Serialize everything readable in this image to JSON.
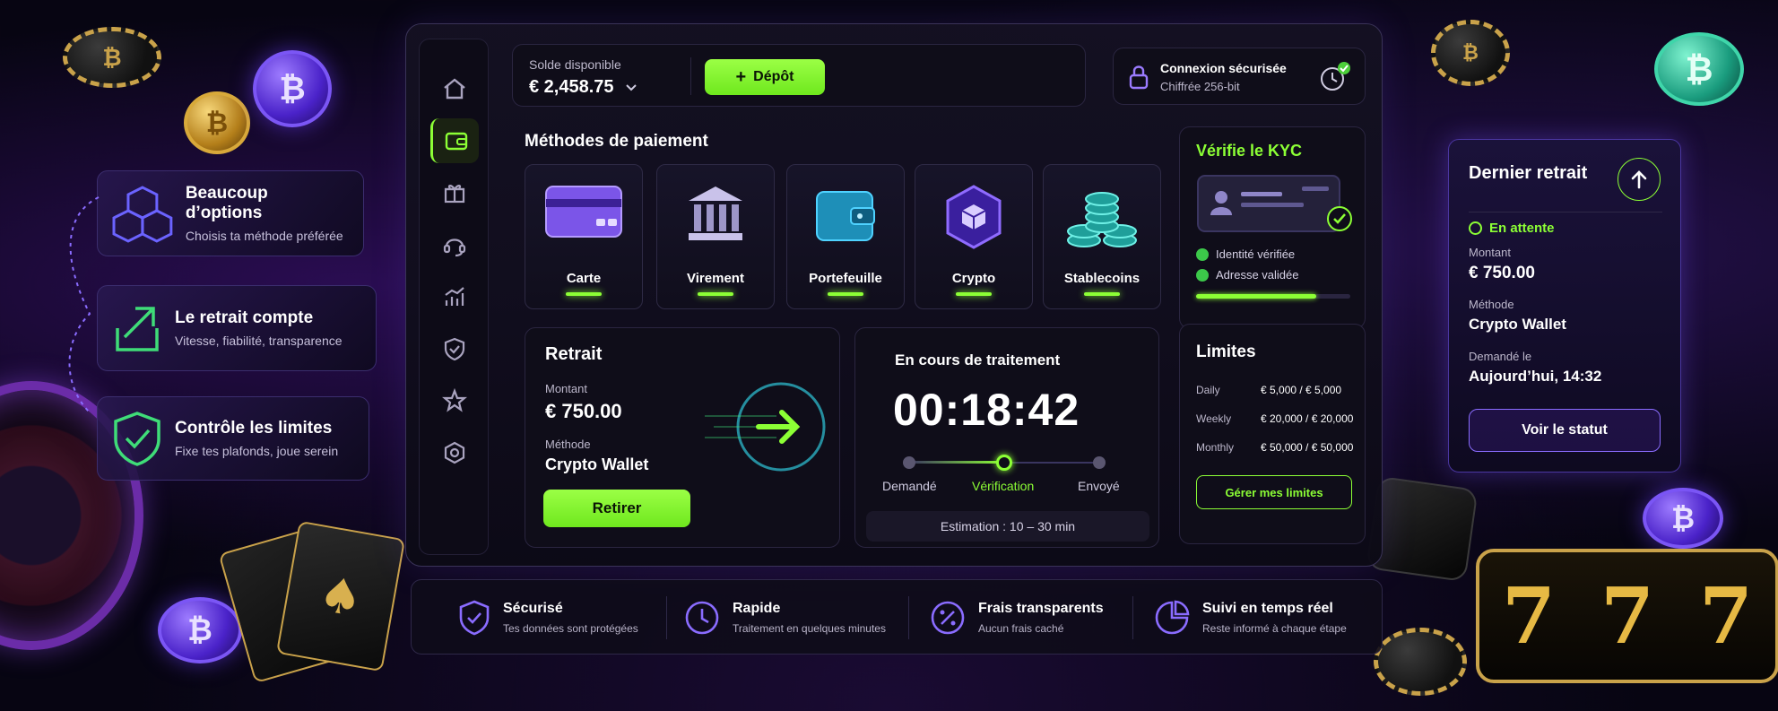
{
  "features": [
    {
      "title": "Beaucoup d’options",
      "subtitle": "Choisis ta méthode préférée",
      "icon": "cubes-icon"
    },
    {
      "title": "Le retrait compte",
      "subtitle": "Vitesse, fiabilité, transparence",
      "icon": "trend-up-arrow-icon"
    },
    {
      "title": "Contrôle les limites",
      "subtitle": "Fixe tes plafonds, joue serein",
      "icon": "shield-check-icon"
    }
  ],
  "sidebar": {
    "items": [
      {
        "name": "home",
        "icon": "home-icon"
      },
      {
        "name": "wallet",
        "icon": "wallet-icon",
        "active": true
      },
      {
        "name": "gift",
        "icon": "gift-icon"
      },
      {
        "name": "support",
        "icon": "headset-icon"
      },
      {
        "name": "stats",
        "icon": "chart-icon"
      },
      {
        "name": "security",
        "icon": "shield-icon"
      },
      {
        "name": "favorites",
        "icon": "star-icon"
      },
      {
        "name": "settings",
        "icon": "hexagon-settings-icon"
      }
    ]
  },
  "header": {
    "balance_label": "Solde disponible",
    "balance_value": "€ 2,458.75",
    "deposit_label": "Dépôt",
    "secure_title": "Connexion sécurisée",
    "secure_subtitle": "Chiffrée 256-bit"
  },
  "payment": {
    "title": "Méthodes de paiement",
    "methods": [
      {
        "label": "Carte",
        "icon": "card-icon"
      },
      {
        "label": "Virement",
        "icon": "bank-icon"
      },
      {
        "label": "Portefeuille",
        "icon": "wallet-icon"
      },
      {
        "label": "Crypto",
        "icon": "crypto-cube-icon"
      },
      {
        "label": "Stablecoins",
        "icon": "coin-stack-icon"
      }
    ]
  },
  "kyc": {
    "title": "Vérifie le KYC",
    "items": [
      "Identité vérifiée",
      "Adresse validée"
    ],
    "progress": 0.78
  },
  "withdraw": {
    "title": "Retrait",
    "amount_label": "Montant",
    "amount": "€ 750.00",
    "method_label": "Méthode",
    "method": "Crypto Wallet",
    "button": "Retirer"
  },
  "processing": {
    "title": "En cours de traitement",
    "timer": "00:18:42",
    "steps": [
      "Demandé",
      "Vérification",
      "Envoyé"
    ],
    "active_step": 1,
    "estimate": "Estimation : 10 – 30 min"
  },
  "limits": {
    "title": "Limites",
    "rows": [
      {
        "period": "Daily",
        "value": "€ 5,000 / € 5,000"
      },
      {
        "period": "Weekly",
        "value": "€ 20,000 / € 20,000"
      },
      {
        "period": "Monthly",
        "value": "€ 50,000 / € 50,000"
      }
    ],
    "button": "Gérer mes limites"
  },
  "last_withdrawal": {
    "title": "Dernier retrait",
    "status": "En attente",
    "amount_label": "Montant",
    "amount": "€ 750.00",
    "method_label": "Méthode",
    "method": "Crypto Wallet",
    "date_label": "Demandé le",
    "date": "Aujourd’hui, 14:32",
    "button": "Voir le statut"
  },
  "bottom": [
    {
      "title": "Sécurisé",
      "subtitle": "Tes données sont protégées",
      "icon": "shield-check-icon"
    },
    {
      "title": "Rapide",
      "subtitle": "Traitement en quelques minutes",
      "icon": "clock-icon"
    },
    {
      "title": "Frais transparents",
      "subtitle": "Aucun frais caché",
      "icon": "percent-icon"
    },
    {
      "title": "Suivi en temps réel",
      "subtitle": "Reste informé à chaque étape",
      "icon": "pie-chart-icon"
    }
  ],
  "colors": {
    "accent": "#8cff35",
    "purple": "#7b56f5",
    "background": "#070512"
  }
}
